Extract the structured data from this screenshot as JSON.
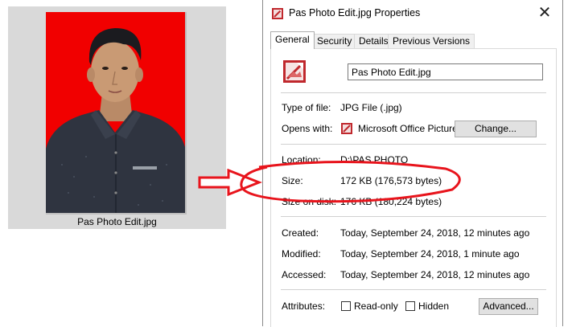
{
  "thumbnail": {
    "caption": "Pas Photo Edit.jpg"
  },
  "dialog": {
    "title": "Pas Photo Edit.jpg Properties",
    "close_glyph": "✕",
    "tabs": [
      {
        "label": "General",
        "active": true
      },
      {
        "label": "Security",
        "active": false
      },
      {
        "label": "Details",
        "active": false
      },
      {
        "label": "Previous Versions",
        "active": false
      }
    ],
    "filename_value": "Pas Photo Edit.jpg",
    "type_label": "Type of file:",
    "type_value": "JPG File (.jpg)",
    "opens_label": "Opens with:",
    "opens_value": "Microsoft Office Picture",
    "change_button": "Change...",
    "location_label": "Location:",
    "location_value": "D:\\PAS PHOTO",
    "size_label": "Size:",
    "size_value": "172 KB (176,573 bytes)",
    "size_on_disk_label": "Size on disk:",
    "size_on_disk_value": "176 KB (180,224 bytes)",
    "created_label": "Created:",
    "created_value": "Today, September 24, 2018, 12 minutes ago",
    "modified_label": "Modified:",
    "modified_value": "Today, September 24, 2018, 1 minute ago",
    "accessed_label": "Accessed:",
    "accessed_value": "Today, September 24, 2018, 12 minutes ago",
    "attributes_label": "Attributes:",
    "readonly_label": "Read-only",
    "readonly_checked": false,
    "hidden_label": "Hidden",
    "hidden_checked": false,
    "advanced_button": "Advanced..."
  },
  "colors": {
    "annotation_red": "#e8141c",
    "photo_background": "#f10000",
    "shirt": "#2f3440"
  },
  "icons": {
    "file": "jpg-file-icon",
    "app": "office-picture-icon",
    "arrow": "right-arrow-outline",
    "highlight": "red-ellipse-annotation"
  }
}
